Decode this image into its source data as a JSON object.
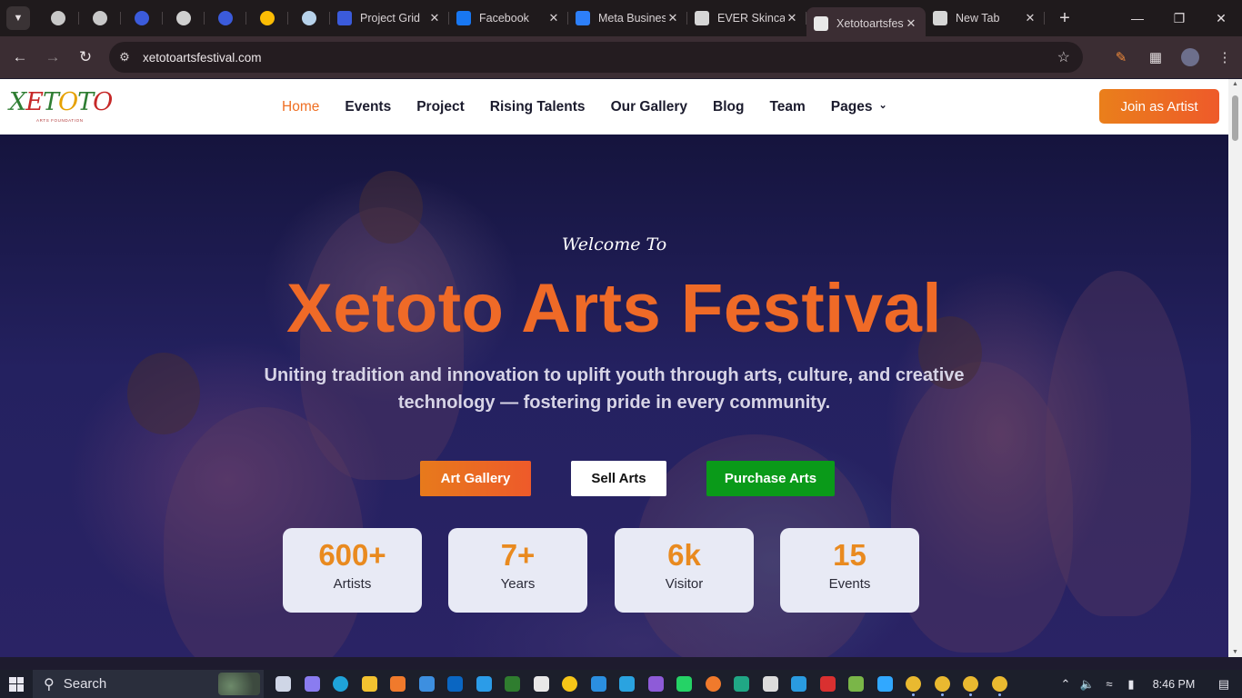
{
  "browser": {
    "pinned_tabs": [
      {
        "icon": "chatgpt-icon",
        "color": "#c8c8c8"
      },
      {
        "icon": "chatgpt-icon",
        "color": "#c8c8c8"
      },
      {
        "icon": "pen-app-icon",
        "color": "#3b5bdb"
      },
      {
        "icon": "globe-icon",
        "color": "#cfcfcf"
      },
      {
        "icon": "pen-app-icon",
        "color": "#3b5bdb"
      },
      {
        "icon": "google-ads-icon",
        "color": "#fbbc04"
      },
      {
        "icon": "cube-icon",
        "color": "#b7d2ea"
      }
    ],
    "tabs": [
      {
        "title": "Project Grid",
        "icon": "pen-app-icon",
        "color": "#3b5bdb",
        "close": "✕",
        "active": false
      },
      {
        "title": "Facebook",
        "icon": "facebook-icon",
        "color": "#1877f2",
        "close": "✕",
        "active": false
      },
      {
        "title": "Meta Business",
        "icon": "meta-icon",
        "color": "#2d7ff9",
        "close": "✕",
        "active": false
      },
      {
        "title": "EVER Skincare",
        "icon": "brand-icon",
        "color": "#d6d6d6",
        "close": "✕",
        "active": false
      },
      {
        "title": "Xetotoartsfestival",
        "icon": "xetoto-favicon-icon",
        "color": "#e8e8e8",
        "close": "✕",
        "active": true
      },
      {
        "title": "New Tab",
        "icon": "chrome-icon",
        "color": "#d6d6d6",
        "close": "✕",
        "active": false
      }
    ],
    "new_tab_glyph": "+",
    "url": "xetotoartsfestival.com"
  },
  "site": {
    "logo_text": "XETOTO",
    "logo_subtext": "ARTS FOUNDATION",
    "nav": [
      {
        "label": "Home",
        "active": true
      },
      {
        "label": "Events",
        "active": false
      },
      {
        "label": "Project",
        "active": false
      },
      {
        "label": "Rising Talents",
        "active": false
      },
      {
        "label": "Our Gallery",
        "active": false
      },
      {
        "label": "Blog",
        "active": false
      },
      {
        "label": "Team",
        "active": false
      },
      {
        "label": "Pages",
        "active": false,
        "dropdown": true
      }
    ],
    "join_label": "Join as Artist",
    "accent_color": "#ef6a27",
    "hero": {
      "welcome": "Welcome To",
      "title": "Xetoto Arts Festival",
      "subtitle": "Uniting tradition and innovation to uplift youth through arts, culture, and creative technology — fostering pride in every community.",
      "buttons": {
        "gallery": "Art Gallery",
        "sell": "Sell Arts",
        "purchase": "Purchase Arts"
      },
      "stats": [
        {
          "value": "600+",
          "label": "Artists"
        },
        {
          "value": "7+",
          "label": "Years"
        },
        {
          "value": "6k",
          "label": "Visitor"
        },
        {
          "value": "15",
          "label": "Events"
        }
      ]
    }
  },
  "taskbar": {
    "search_label": "Search",
    "apps": [
      {
        "icon": "task-view-icon",
        "color": "#cfd6e6"
      },
      {
        "icon": "copilot-icon",
        "color": "#8a7cf0"
      },
      {
        "icon": "edge-icon",
        "color": "#1fa3d9"
      },
      {
        "icon": "file-explorer-icon",
        "color": "#f2c230"
      },
      {
        "icon": "app-orange-icon",
        "color": "#f07a2c"
      },
      {
        "icon": "keyboard-icon",
        "color": "#3d8fe0"
      },
      {
        "icon": "linkedin-icon",
        "color": "#0a66c2"
      },
      {
        "icon": "shield-icon",
        "color": "#2b9ce8"
      },
      {
        "icon": "xd-icon",
        "color": "#2f7d2f"
      },
      {
        "icon": "tiktok-icon",
        "color": "#e8e8e8"
      },
      {
        "icon": "yellow-app-icon",
        "color": "#f5c518"
      },
      {
        "icon": "vscode-icon",
        "color": "#2b8fe0"
      },
      {
        "icon": "telegram-icon",
        "color": "#2aa3e0"
      },
      {
        "icon": "purple-app-icon",
        "color": "#8e5bd8"
      },
      {
        "icon": "whatsapp-icon",
        "color": "#25d366"
      },
      {
        "icon": "firefox-icon",
        "color": "#f07a2c"
      },
      {
        "icon": "green-app-icon",
        "color": "#20a785"
      },
      {
        "icon": "chatgpt-icon",
        "color": "#dcdcdc"
      },
      {
        "icon": "sheets-app-icon",
        "color": "#2a9be0"
      },
      {
        "icon": "red-app-icon",
        "color": "#d93030"
      },
      {
        "icon": "image-app-icon",
        "color": "#7ab648"
      },
      {
        "icon": "photoshop-icon",
        "color": "#31a8ff"
      },
      {
        "icon": "chrome-icon",
        "color": "#e9b930"
      },
      {
        "icon": "chrome-icon",
        "color": "#e9b930"
      },
      {
        "icon": "chrome-icon",
        "color": "#e9b930"
      },
      {
        "icon": "chrome-icon",
        "color": "#e9b930"
      }
    ],
    "time": "8:46 PM"
  }
}
